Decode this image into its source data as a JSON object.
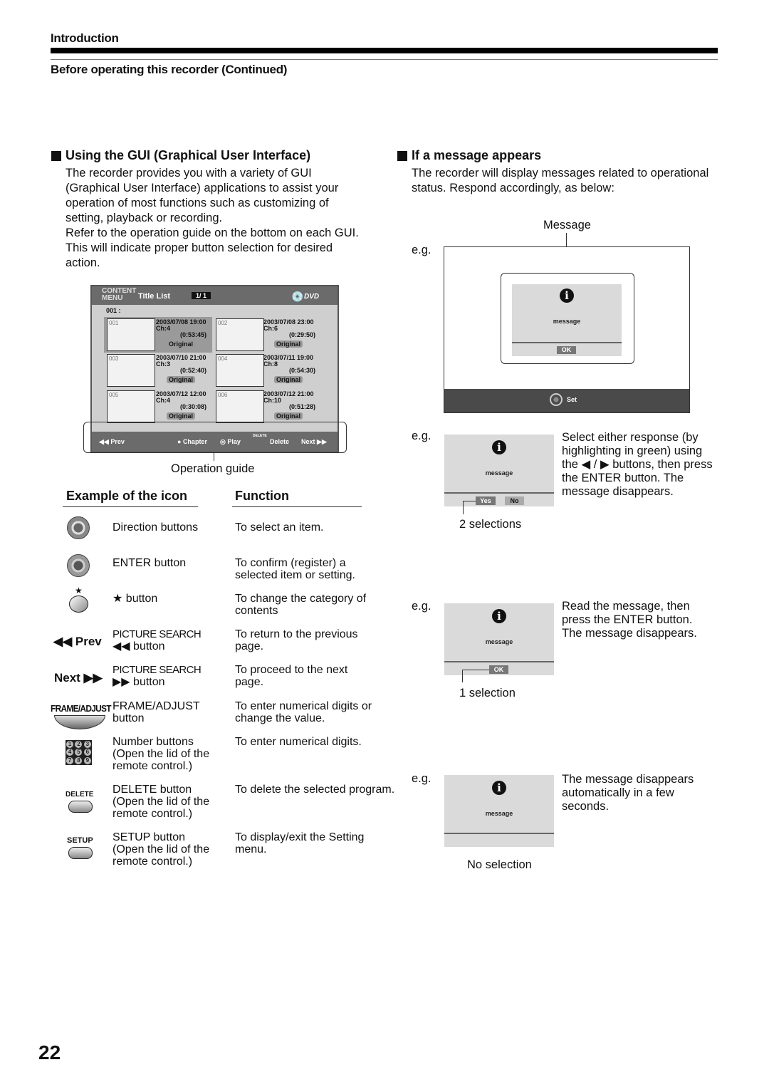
{
  "header": {
    "section": "Introduction",
    "subsection": "Before operating this recorder (Continued)"
  },
  "gui_section": {
    "title": "Using the GUI (Graphical User Interface)",
    "paragraph1": "The recorder provides you with a variety of GUI (Graphical User Interface) applications to assist your operation of most functions such as customizing of setting, playback or recording.",
    "paragraph2": "Refer to the operation guide on the bottom on each GUI. This will indicate proper button selection for desired action.",
    "screen": {
      "menu_label_1": "CONTENT",
      "menu_label_2": "MENU",
      "title": "Title List",
      "page": "1/ 1",
      "disc": "DVD",
      "selected_row": "001  :",
      "titles": [
        {
          "num": "001",
          "date": "2003/07/08 19:00",
          "ch": "Ch:4",
          "dur": "(0:53:45)",
          "tag": "Original"
        },
        {
          "num": "002",
          "date": "2003/07/08 23:00",
          "ch": "Ch:6",
          "dur": "(0:29:50)",
          "tag": "Original"
        },
        {
          "num": "003",
          "date": "2003/07/10 21:00",
          "ch": "Ch:3",
          "dur": "(0:52:40)",
          "tag": "Original"
        },
        {
          "num": "004",
          "date": "2003/07/11 19:00",
          "ch": "Ch:8",
          "dur": "(0:54:30)",
          "tag": "Original"
        },
        {
          "num": "005",
          "date": "2003/07/12 12:00",
          "ch": "Ch:4",
          "dur": "(0:30:08)",
          "tag": "Original"
        },
        {
          "num": "006",
          "date": "2003/07/12 21:00",
          "ch": "Ch:10",
          "dur": "(0:51:28)",
          "tag": "Original"
        }
      ],
      "guide": {
        "prev": "Prev",
        "chapter": "Chapter",
        "play": "Play",
        "delete_small": "DELETE",
        "delete": "Delete",
        "next": "Next"
      }
    },
    "caption": "Operation guide"
  },
  "icon_table": {
    "col1": "Example of the icon",
    "col2": "Function",
    "rows": [
      {
        "icon": "direction-buttons-icon",
        "name": "Direction buttons",
        "function": "To select an item."
      },
      {
        "icon": "enter-button-icon",
        "name": "ENTER button",
        "function": "To confirm (register) a selected item or setting."
      },
      {
        "icon": "star-button-icon",
        "name": "★ button",
        "function": "To change the category of contents"
      },
      {
        "icon_label": "◀◀ Prev",
        "name": "PICTURE SEARCH ◀◀ button",
        "name_line1": "PICTURE SEARCH",
        "name_line2": "◀◀ button",
        "function": "To return to the previous page."
      },
      {
        "icon_label": "Next ▶▶",
        "name_line1": "PICTURE SEARCH",
        "name_line2": "▶▶ button",
        "function": "To proceed to the next page."
      },
      {
        "icon_label": "FRAME/ADJUST",
        "name_line1": "FRAME/ADJUST",
        "name_line2": "button",
        "function": "To enter numerical digits or change the value."
      },
      {
        "icon": "number-buttons-icon",
        "name_line1": "Number buttons",
        "name_line2": "(Open the lid of the remote control.)",
        "function": "To enter numerical digits."
      },
      {
        "icon_label": "DELETE",
        "name_line1": "DELETE button",
        "name_line2": "(Open the lid of the remote control.)",
        "function": "To delete the selected program."
      },
      {
        "icon_label": "SETUP",
        "name_line1": "SETUP button",
        "name_line2": "(Open the lid of the remote control.)",
        "function": "To display/exit the Setting menu."
      }
    ],
    "digits": [
      "1",
      "2",
      "3",
      "4",
      "5",
      "6",
      "7",
      "8",
      "9"
    ]
  },
  "message_section": {
    "title": "If a message appears",
    "paragraph": "The recorder will display messages related to operational status. Respond accordingly, as below:",
    "eg": "e.g.",
    "example1": {
      "callout": "Message",
      "message": "message",
      "ok": "OK",
      "set": "Set"
    },
    "example2": {
      "message": "message",
      "yes": "Yes",
      "no": "No",
      "caption": "2 selections",
      "description": "Select either response (by highlighting in green) using the ◀ / ▶ buttons, then press the ENTER button. The message disappears."
    },
    "example3": {
      "message": "message",
      "ok": "OK",
      "caption": "1 selection",
      "description": "Read the message, then press the ENTER button. The message disappears."
    },
    "example4": {
      "message": "message",
      "caption": "No selection",
      "description": "The message disappears automatically in a few seconds."
    }
  },
  "page_number": "22"
}
